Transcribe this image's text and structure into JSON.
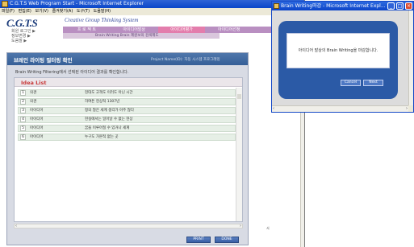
{
  "main_window": {
    "title": "C.G.T.S Web Program Start - Microsoft Internet Explorer",
    "menu": [
      "파일(F)",
      "편집(E)",
      "보기(V)",
      "즐겨찾기(A)",
      "도구(T)",
      "도움말(H)"
    ]
  },
  "header": {
    "logo": "C.G.T.S",
    "tagline": "Creative Group Thinking System",
    "side_links": [
      "회원 로그인 ▶",
      "정보변경 ▶",
      "도움말 ▶"
    ],
    "top_nav": [
      "프 로 젝 트",
      "아이디어발상",
      "아이디어평가",
      "아이디어선정",
      "폐 시"
    ],
    "active_nav_index": 2,
    "sub_nav": "Brain Writing Brain 제원보의 검색제도"
  },
  "content": {
    "title": "브레인 라이팅 필터링 확인",
    "project_name": "Project Name(ID): 자동 시스템 프로그래밍",
    "instruction": "Brain Writing Filtering에서 선택된 아이디어 결과를 확인합니다.",
    "list_title": "Idea List",
    "rows": [
      {
        "num": "1",
        "type": "의견",
        "text": "현대도 고객도 이러도 아닌 시간"
      },
      {
        "num": "2",
        "type": "의견",
        "text": "하여튼 현상적 1307년"
      },
      {
        "num": "3",
        "type": "아이디어",
        "text": "정의 많은 세계 생각가 아주 많다"
      },
      {
        "num": "4",
        "type": "아이디어",
        "text": "현실에서는 일어날 수 없는 현상"
      },
      {
        "num": "5",
        "type": "아이디어",
        "text": "꿈을 이루어질 수 있거나 세계"
      },
      {
        "num": "6",
        "type": "아이디어",
        "text": "누구도 가본적 없는 곳"
      }
    ],
    "buttons": {
      "print": "PRINT",
      "done": "DONE"
    },
    "page_note": "서"
  },
  "popup": {
    "title": "Brain Writing마감 - Microsoft Internet Expl...",
    "message": "아이디어 발상의 Brain Writing을 마감합니다.",
    "cancel": "Cancel",
    "next": "Next"
  }
}
